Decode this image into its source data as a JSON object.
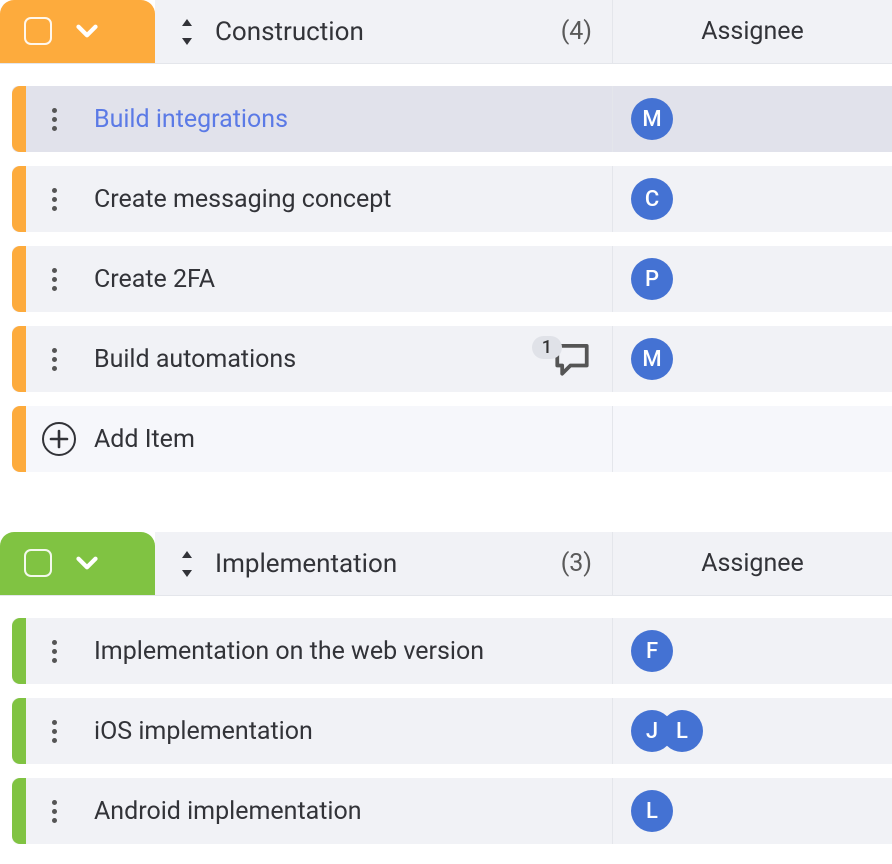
{
  "columns": {
    "assignee": "Assignee"
  },
  "groups": [
    {
      "id": "construction",
      "name": "Construction",
      "count": "(4)",
      "color": "#fdab3d",
      "tasks": [
        {
          "title": "Build integrations",
          "highlight": true,
          "link": true,
          "assignees": [
            "M"
          ],
          "comments": null
        },
        {
          "title": "Create messaging concept",
          "highlight": false,
          "link": false,
          "assignees": [
            "C"
          ],
          "comments": null
        },
        {
          "title": "Create 2FA",
          "highlight": false,
          "link": false,
          "assignees": [
            "P"
          ],
          "comments": null
        },
        {
          "title": "Build automations",
          "highlight": false,
          "link": false,
          "assignees": [
            "M"
          ],
          "comments": "1"
        }
      ],
      "add_item": "Add Item"
    },
    {
      "id": "implementation",
      "name": "Implementation",
      "count": "(3)",
      "color": "#80c342",
      "tasks": [
        {
          "title": "Implementation on the web version",
          "highlight": false,
          "link": false,
          "assignees": [
            "F"
          ],
          "comments": null
        },
        {
          "title": "iOS implementation",
          "highlight": false,
          "link": false,
          "assignees": [
            "J",
            "L"
          ],
          "comments": null
        },
        {
          "title": "Android implementation",
          "highlight": false,
          "link": false,
          "assignees": [
            "L"
          ],
          "comments": null
        }
      ],
      "add_item": null
    }
  ]
}
